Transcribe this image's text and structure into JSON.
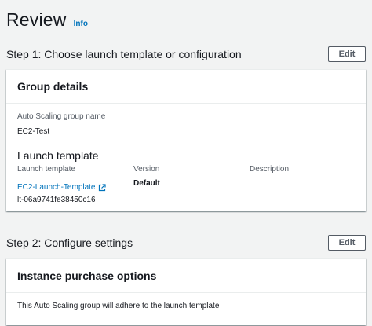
{
  "page": {
    "title": "Review",
    "info_label": "Info"
  },
  "step1": {
    "title": "Step 1: Choose launch template or configuration",
    "edit_label": "Edit",
    "group_details": {
      "title": "Group details",
      "asg_name_label": "Auto Scaling group name",
      "asg_name_value": "EC2-Test"
    },
    "launch_template": {
      "heading": "Launch template",
      "col_template_label": "Launch template",
      "col_version_label": "Version",
      "col_description_label": "Description",
      "template_name": "EC2-Launch-Template",
      "template_id": "lt-06a9741fe38450c16",
      "version_value": "Default",
      "description_value": ""
    }
  },
  "step2": {
    "title": "Step 2: Configure settings",
    "edit_label": "Edit",
    "instance_purchase": {
      "title": "Instance purchase options",
      "text": "This Auto Scaling group will adhere to the launch template"
    }
  },
  "colors": {
    "link": "#0073bb",
    "background": "#f2f3f3",
    "text": "#16191f"
  },
  "icons": {
    "external_link": "external-link-icon"
  }
}
